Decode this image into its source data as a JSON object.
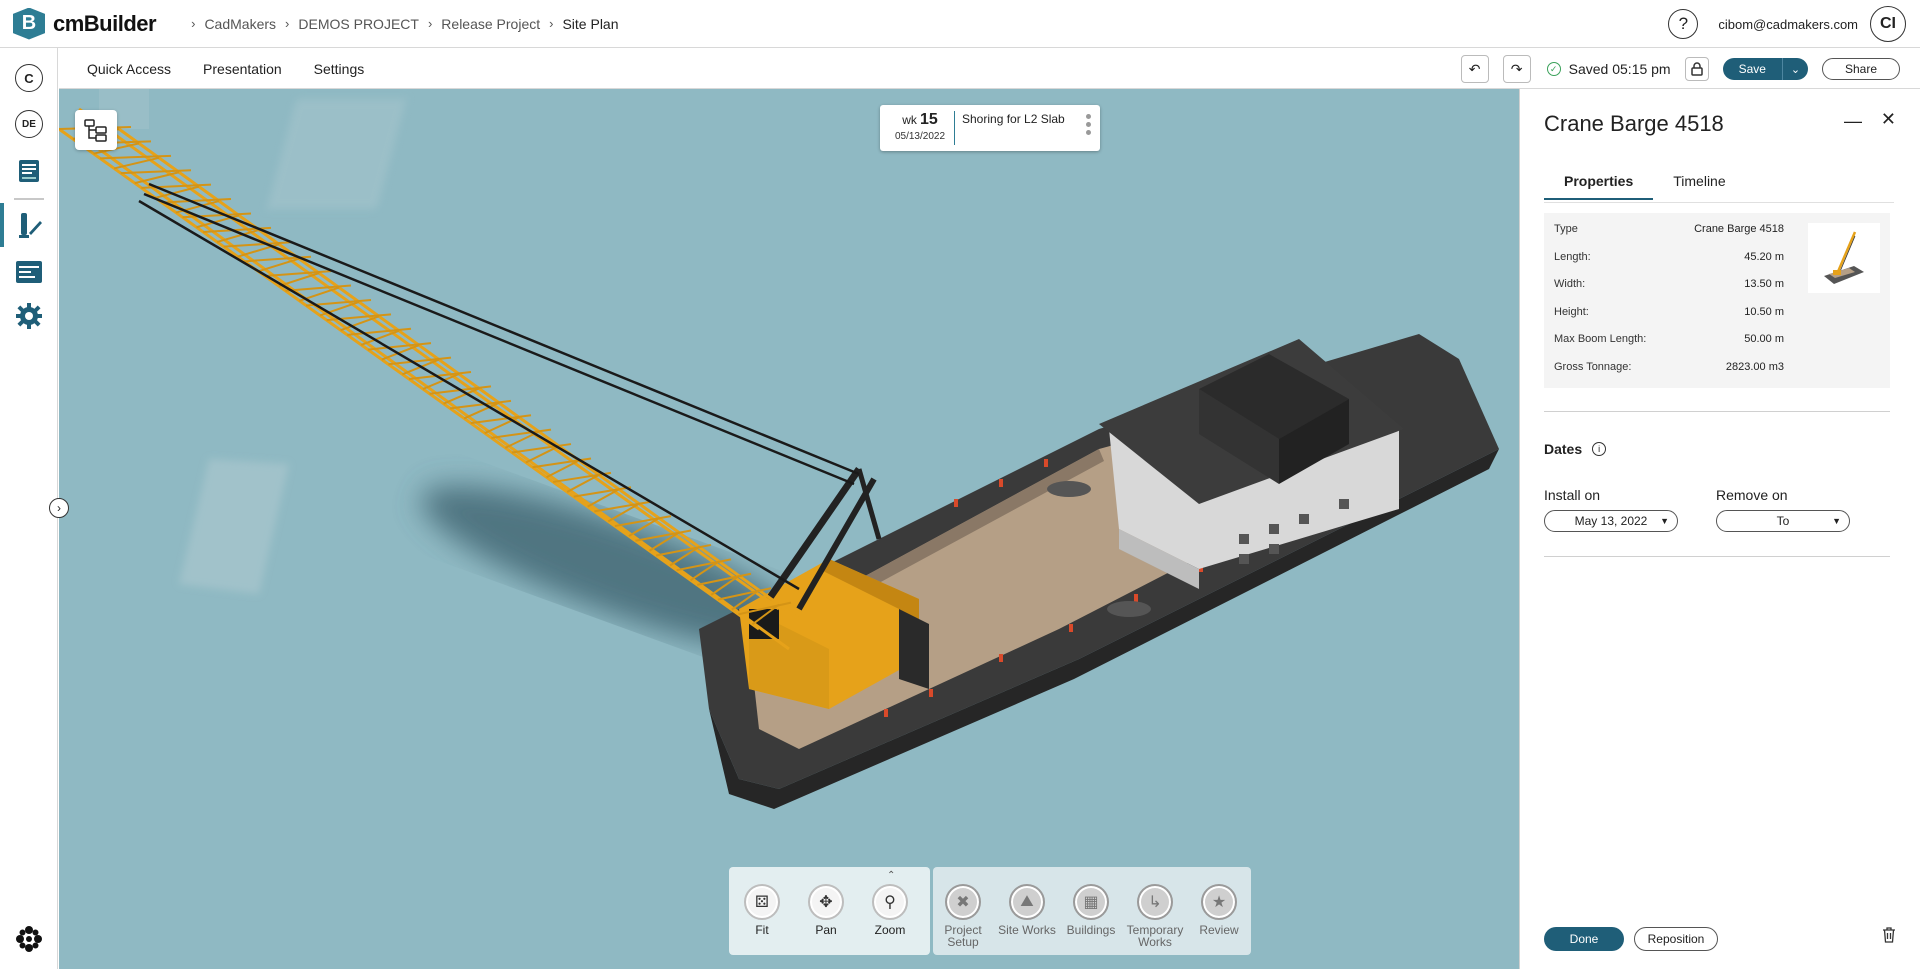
{
  "app": {
    "logo_letter": "B",
    "brand": "cmBuilder"
  },
  "breadcrumb": [
    "CadMakers",
    "DEMOS PROJECT",
    "Release Project",
    "Site Plan"
  ],
  "user": {
    "email": "cibom@cadmakers.com",
    "initials": "CI",
    "help": "?"
  },
  "rail": {
    "company_initial": "C",
    "user_initials": "DE"
  },
  "menu": {
    "quick_access": "Quick Access",
    "presentation": "Presentation",
    "settings": "Settings"
  },
  "toolbar": {
    "saved_text": "Saved 05:15 pm",
    "save_label": "Save",
    "share_label": "Share"
  },
  "schedule_card": {
    "wk_prefix": "wk",
    "week": "15",
    "date": "05/13/2022",
    "task": "Shoring for L2 Slab"
  },
  "view_tools": [
    {
      "label": "Fit",
      "icon": "fit-icon"
    },
    {
      "label": "Pan",
      "icon": "pan-icon"
    },
    {
      "label": "Zoom",
      "icon": "zoom-icon"
    }
  ],
  "categories": [
    {
      "label": "Project Setup",
      "icon": "tools-icon"
    },
    {
      "label": "Site Works",
      "icon": "excavator-icon"
    },
    {
      "label": "Buildings",
      "icon": "building-icon"
    },
    {
      "label": "Temporary Works",
      "icon": "crane-icon"
    },
    {
      "label": "Review",
      "icon": "review-icon"
    }
  ],
  "panel": {
    "title": "Crane Barge 4518",
    "tabs": [
      "Properties",
      "Timeline"
    ],
    "properties": [
      {
        "key": "Type",
        "value": "Crane Barge 4518"
      },
      {
        "key": "Length:",
        "value": "45.20 m"
      },
      {
        "key": "Width:",
        "value": "13.50 m"
      },
      {
        "key": "Height:",
        "value": "10.50 m"
      },
      {
        "key": "Max Boom Length:",
        "value": "50.00 m"
      },
      {
        "key": "Gross Tonnage:",
        "value": "2823.00 m3"
      }
    ],
    "dates_heading": "Dates",
    "install_label": "Install on",
    "install_value": "May 13, 2022",
    "remove_label": "Remove on",
    "remove_value": "To",
    "done_label": "Done",
    "reposition_label": "Reposition"
  },
  "colors": {
    "accent": "#1f5e78",
    "water": "#8fb9c3",
    "crane_yellow": "#e6a21a"
  }
}
